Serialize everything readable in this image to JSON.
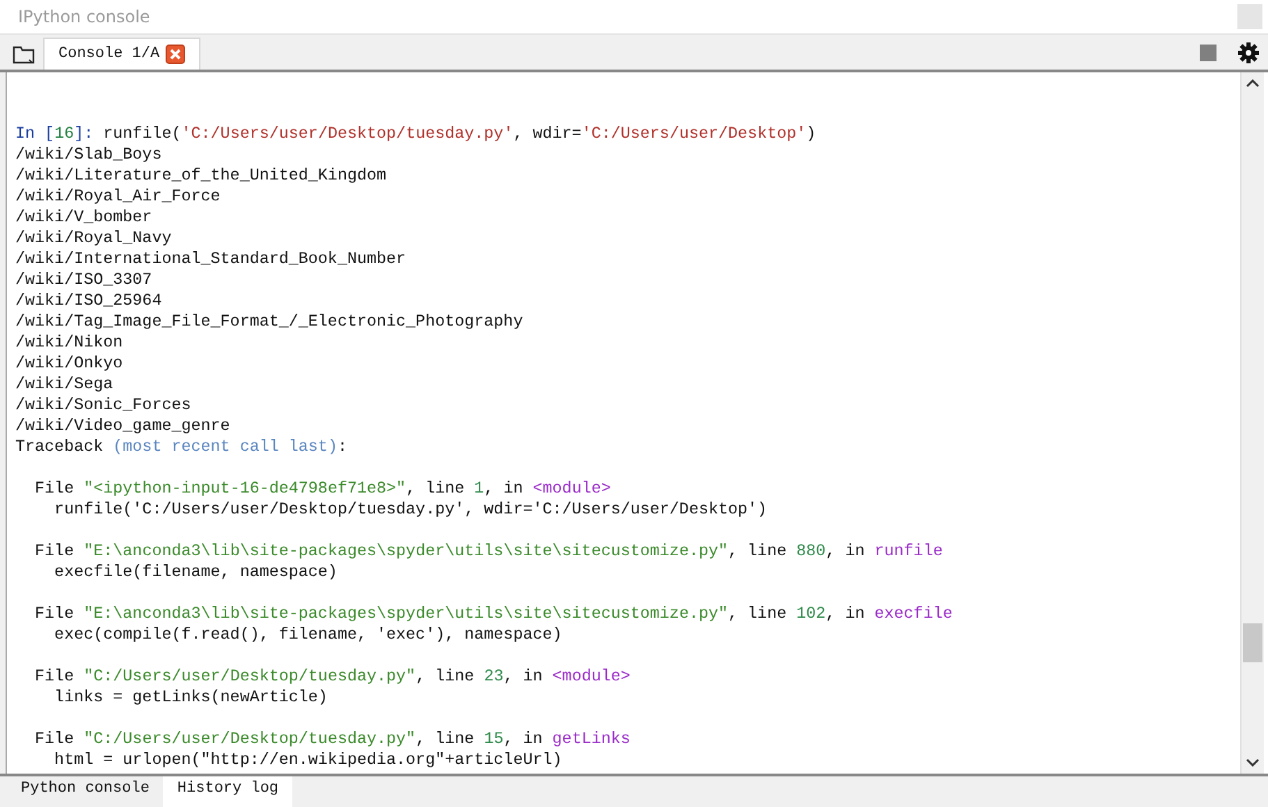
{
  "window": {
    "title": "IPython console"
  },
  "tabs": [
    {
      "label": "Console 1/A",
      "selected": true,
      "closable": true
    }
  ],
  "console": {
    "lines": [
      {
        "kind": "blank"
      },
      {
        "kind": "text",
        "segments": [
          {
            "kind": "prompt",
            "text": "In ["
          },
          {
            "kind": "number",
            "text": "16"
          },
          {
            "kind": "prompt",
            "text": "]: "
          },
          {
            "kind": "plain",
            "text": "runfile("
          },
          {
            "kind": "string",
            "text": "'C:/Users/user/Desktop/tuesday.py'"
          },
          {
            "kind": "plain",
            "text": ", wdir="
          },
          {
            "kind": "string",
            "text": "'C:/Users/user/Desktop'"
          },
          {
            "kind": "plain",
            "text": ")"
          }
        ]
      },
      {
        "kind": "text",
        "segments": [
          {
            "kind": "plain",
            "text": "/wiki/Slab_Boys"
          }
        ]
      },
      {
        "kind": "text",
        "segments": [
          {
            "kind": "plain",
            "text": "/wiki/Literature_of_the_United_Kingdom"
          }
        ]
      },
      {
        "kind": "text",
        "segments": [
          {
            "kind": "plain",
            "text": "/wiki/Royal_Air_Force"
          }
        ]
      },
      {
        "kind": "text",
        "segments": [
          {
            "kind": "plain",
            "text": "/wiki/V_bomber"
          }
        ]
      },
      {
        "kind": "text",
        "segments": [
          {
            "kind": "plain",
            "text": "/wiki/Royal_Navy"
          }
        ]
      },
      {
        "kind": "text",
        "segments": [
          {
            "kind": "plain",
            "text": "/wiki/International_Standard_Book_Number"
          }
        ]
      },
      {
        "kind": "text",
        "segments": [
          {
            "kind": "plain",
            "text": "/wiki/ISO_3307"
          }
        ]
      },
      {
        "kind": "text",
        "segments": [
          {
            "kind": "plain",
            "text": "/wiki/ISO_25964"
          }
        ]
      },
      {
        "kind": "text",
        "segments": [
          {
            "kind": "plain",
            "text": "/wiki/Tag_Image_File_Format_/_Electronic_Photography"
          }
        ]
      },
      {
        "kind": "text",
        "segments": [
          {
            "kind": "plain",
            "text": "/wiki/Nikon"
          }
        ]
      },
      {
        "kind": "text",
        "segments": [
          {
            "kind": "plain",
            "text": "/wiki/Onkyo"
          }
        ]
      },
      {
        "kind": "text",
        "segments": [
          {
            "kind": "plain",
            "text": "/wiki/Sega"
          }
        ]
      },
      {
        "kind": "text",
        "segments": [
          {
            "kind": "plain",
            "text": "/wiki/Sonic_Forces"
          }
        ]
      },
      {
        "kind": "text",
        "segments": [
          {
            "kind": "plain",
            "text": "/wiki/Video_game_genre"
          }
        ]
      },
      {
        "kind": "text",
        "segments": [
          {
            "kind": "plain",
            "text": "Traceback "
          },
          {
            "kind": "dim",
            "text": "(most recent call last)"
          },
          {
            "kind": "plain",
            "text": ":"
          }
        ]
      },
      {
        "kind": "blank"
      },
      {
        "kind": "text",
        "segments": [
          {
            "kind": "plain",
            "text": "  File "
          },
          {
            "kind": "path",
            "text": "\"<ipython-input-16-de4798ef71e8>\""
          },
          {
            "kind": "plain",
            "text": ", line "
          },
          {
            "kind": "lineno",
            "text": "1"
          },
          {
            "kind": "plain",
            "text": ", in "
          },
          {
            "kind": "func",
            "text": "<module>"
          }
        ]
      },
      {
        "kind": "text",
        "segments": [
          {
            "kind": "plain",
            "text": "    runfile('C:/Users/user/Desktop/tuesday.py', wdir='C:/Users/user/Desktop')"
          }
        ]
      },
      {
        "kind": "blank"
      },
      {
        "kind": "text",
        "segments": [
          {
            "kind": "plain",
            "text": "  File "
          },
          {
            "kind": "path",
            "text": "\"E:\\anconda3\\lib\\site-packages\\spyder\\utils\\site\\sitecustomize.py\""
          },
          {
            "kind": "plain",
            "text": ", line "
          },
          {
            "kind": "lineno",
            "text": "880"
          },
          {
            "kind": "plain",
            "text": ", in "
          },
          {
            "kind": "func",
            "text": "runfile"
          }
        ]
      },
      {
        "kind": "text",
        "segments": [
          {
            "kind": "plain",
            "text": "    execfile(filename, namespace)"
          }
        ]
      },
      {
        "kind": "blank"
      },
      {
        "kind": "text",
        "segments": [
          {
            "kind": "plain",
            "text": "  File "
          },
          {
            "kind": "path",
            "text": "\"E:\\anconda3\\lib\\site-packages\\spyder\\utils\\site\\sitecustomize.py\""
          },
          {
            "kind": "plain",
            "text": ", line "
          },
          {
            "kind": "lineno",
            "text": "102"
          },
          {
            "kind": "plain",
            "text": ", in "
          },
          {
            "kind": "func",
            "text": "execfile"
          }
        ]
      },
      {
        "kind": "text",
        "segments": [
          {
            "kind": "plain",
            "text": "    exec(compile(f.read(), filename, 'exec'), namespace)"
          }
        ]
      },
      {
        "kind": "blank"
      },
      {
        "kind": "text",
        "segments": [
          {
            "kind": "plain",
            "text": "  File "
          },
          {
            "kind": "path",
            "text": "\"C:/Users/user/Desktop/tuesday.py\""
          },
          {
            "kind": "plain",
            "text": ", line "
          },
          {
            "kind": "lineno",
            "text": "23"
          },
          {
            "kind": "plain",
            "text": ", in "
          },
          {
            "kind": "func",
            "text": "<module>"
          }
        ]
      },
      {
        "kind": "text",
        "segments": [
          {
            "kind": "plain",
            "text": "    links = getLinks(newArticle)"
          }
        ]
      },
      {
        "kind": "blank"
      },
      {
        "kind": "text",
        "segments": [
          {
            "kind": "plain",
            "text": "  File "
          },
          {
            "kind": "path",
            "text": "\"C:/Users/user/Desktop/tuesday.py\""
          },
          {
            "kind": "plain",
            "text": ", line "
          },
          {
            "kind": "lineno",
            "text": "15"
          },
          {
            "kind": "plain",
            "text": ", in "
          },
          {
            "kind": "func",
            "text": "getLinks"
          }
        ]
      },
      {
        "kind": "text",
        "segments": [
          {
            "kind": "plain",
            "text": "    html = urlopen(\"http://en.wikipedia.org\"+articleUrl)"
          }
        ]
      }
    ]
  },
  "bottom_tabs": [
    {
      "label": "Python console",
      "selected": false
    },
    {
      "label": "History log",
      "selected": true
    }
  ]
}
